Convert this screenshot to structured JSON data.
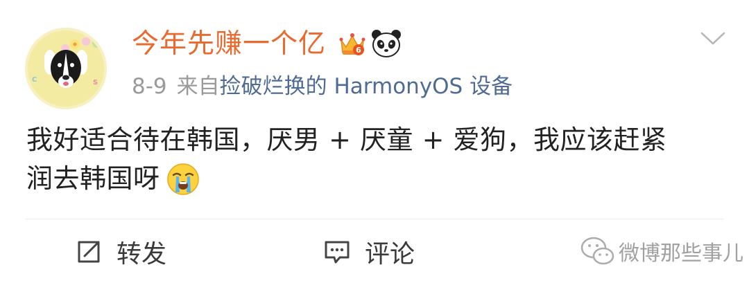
{
  "post": {
    "username": "今年先赚一个亿",
    "date": "8-9",
    "from_prefix": "来自",
    "source": "捡破烂换的 HarmonyOS 设备",
    "text_line_1": "我好适合待在韩国，厌男 + 厌童 + 爱狗，我应该赶紧",
    "text_line_2": "润去韩国呀"
  },
  "badges": [
    "crown-badge-icon",
    "panda-badge-icon"
  ],
  "actions": {
    "repost_label": "转发",
    "comment_label": "评论"
  },
  "watermark": {
    "text": "微博那些事儿"
  },
  "colors": {
    "username": "#e86a2e",
    "source_link": "#4f6b95",
    "meta": "#9a9a9a",
    "body_text": "#222222"
  }
}
